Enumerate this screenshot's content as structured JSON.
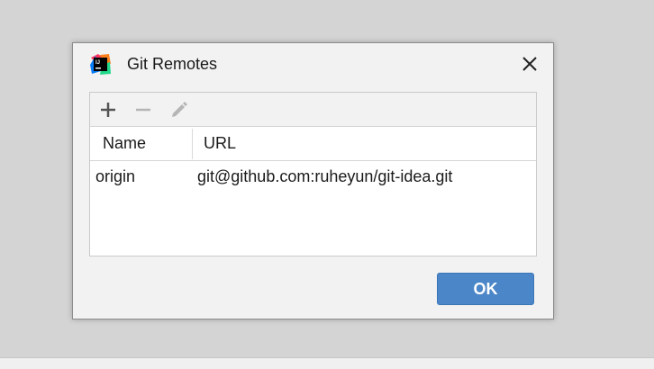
{
  "dialog": {
    "title": "Git Remotes",
    "app_icon": "intellij-idea-icon",
    "close_icon": "close-icon"
  },
  "toolbar": {
    "add_icon": "plus-icon",
    "remove_icon": "minus-icon",
    "edit_icon": "pencil-icon",
    "remove_enabled": false,
    "edit_enabled": false
  },
  "table": {
    "columns": [
      "Name",
      "URL"
    ],
    "rows": [
      {
        "name": "origin",
        "url": "git@github.com:ruheyun/git-idea.git"
      }
    ]
  },
  "buttons": {
    "ok_label": "OK"
  },
  "colors": {
    "accent": "#4a86c8",
    "dialog_bg": "#f2f2f2",
    "table_bg": "#ffffff",
    "disabled_icon": "#b5b5b5",
    "icon": "#555555"
  }
}
